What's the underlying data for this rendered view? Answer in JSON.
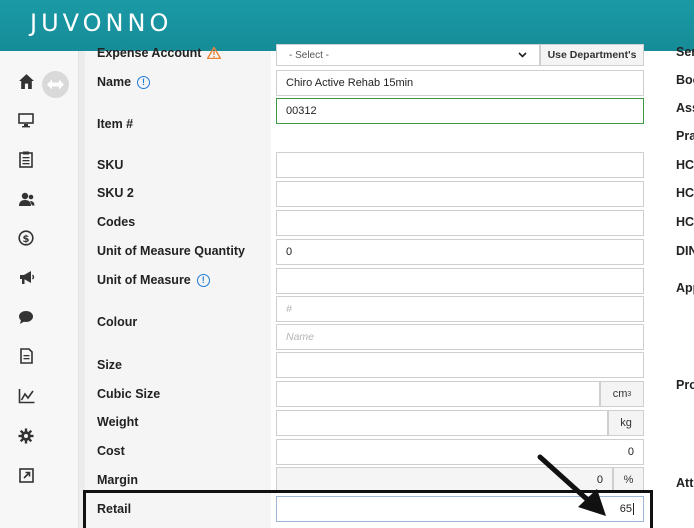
{
  "app": {
    "logo": "JUVONNO"
  },
  "sidebar": {
    "icons": [
      "home-icon",
      "monitor-icon",
      "clipboard-icon",
      "users-icon",
      "dollar-icon",
      "megaphone-icon",
      "chat-icon",
      "document-icon",
      "chart-icon",
      "gear-icon",
      "external-link-icon"
    ]
  },
  "form": {
    "expense_account": {
      "label": "Expense Account",
      "select_value": "- Select -",
      "button": "Use Department's"
    },
    "name": {
      "label": "Name",
      "value": "Chiro Active Rehab 15min"
    },
    "item_number": {
      "label": "Item #",
      "value": "00312"
    },
    "sku": {
      "label": "SKU",
      "value": ""
    },
    "sku2": {
      "label": "SKU 2",
      "value": ""
    },
    "codes": {
      "label": "Codes",
      "value": ""
    },
    "uom_quantity": {
      "label": "Unit of Measure Quantity",
      "value": "0"
    },
    "uom": {
      "label": "Unit of Measure",
      "value": ""
    },
    "colour": {
      "label": "Colour",
      "hex_placeholder": "#",
      "name_placeholder": "Name"
    },
    "size": {
      "label": "Size",
      "value": ""
    },
    "cubic_size": {
      "label": "Cubic Size",
      "value": "",
      "unit": "cm",
      "unit_sup": "3"
    },
    "weight": {
      "label": "Weight",
      "value": "",
      "unit": "kg"
    },
    "cost": {
      "label": "Cost",
      "value": "0"
    },
    "margin": {
      "label": "Margin",
      "value": "0",
      "unit": "%"
    },
    "retail": {
      "label": "Retail",
      "value": "65"
    }
  },
  "right_column": {
    "labels": [
      "Ser",
      "Boo",
      "Ass",
      "Pra",
      "HC",
      "HC",
      "HC",
      "DIN",
      "App",
      "Pro",
      "Att"
    ]
  },
  "colors": {
    "header": "#1a9aa6",
    "info": "#1f7ad6",
    "warning": "#e8833a",
    "valid": "#3c9a47"
  }
}
